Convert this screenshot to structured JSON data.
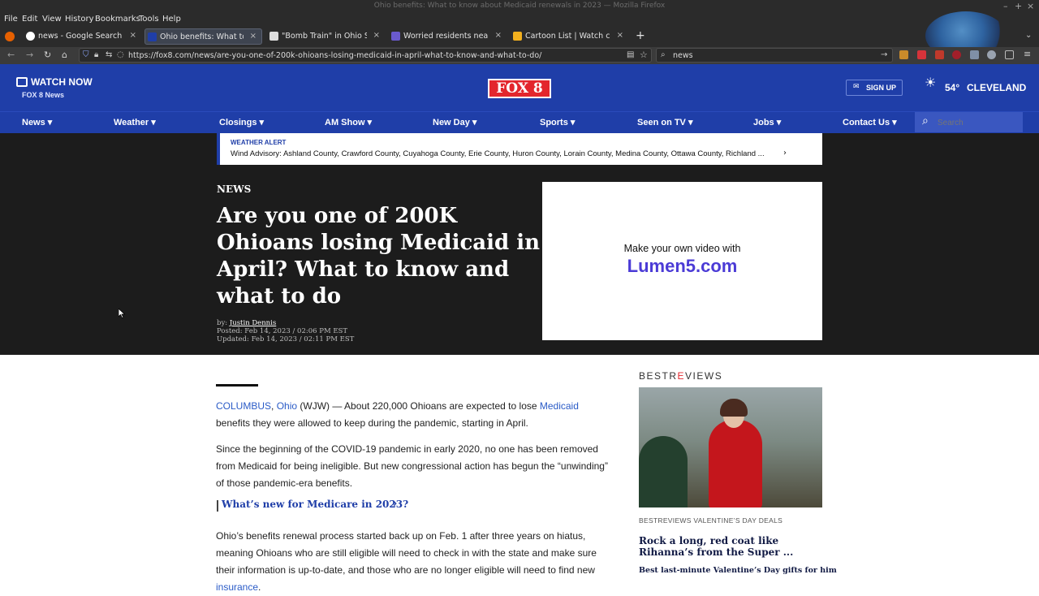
{
  "window": {
    "title": "Ohio benefits: What to know about Medicaid renewals in 2023 — Mozilla Firefox",
    "controls": [
      "–",
      "+",
      "×"
    ]
  },
  "menu": [
    "File",
    "Edit",
    "View",
    "History",
    "Bookmarks",
    "Tools",
    "Help"
  ],
  "tabs": [
    {
      "label": "news - Google Search",
      "active": false
    },
    {
      "label": "Ohio benefits: What to know",
      "active": true
    },
    {
      "label": "\"Bomb Train\" in Ohio Sicken",
      "active": false
    },
    {
      "label": "Worried residents near Ohio",
      "active": false
    },
    {
      "label": "Cartoon List | Watch cartoon",
      "active": false
    }
  ],
  "new_tab": "+",
  "address": {
    "url": "https://fox8.com/news/are-you-one-of-200k-ohioans-losing-medicaid-in-april-what-to-know-and-what-to-do/",
    "search_value": "news"
  },
  "site": {
    "watch_now": "WATCH NOW",
    "watch_sub": "FOX 8 News",
    "logo": "FOX 8",
    "sign_up": "SIGN UP",
    "weather_temp": "54°",
    "weather_city": "CLEVELAND",
    "nav": [
      "News ▾",
      "Weather ▾",
      "Closings ▾",
      "AM Show ▾",
      "New Day ▾",
      "Sports ▾",
      "Seen on TV ▾",
      "Jobs ▾",
      "Contact Us ▾"
    ],
    "search_placeholder": "Search"
  },
  "alert": {
    "label": "WEATHER ALERT",
    "text": "Wind Advisory: Ashland County, Crawford County, Cuyahoga County, Erie County, Huron County, Lorain County, Medina County, Ottawa County, Richland ..."
  },
  "article": {
    "section": "NEWS",
    "headline": "Are you one of 200K Ohioans losing Medicaid in April? What to know and what to do",
    "by_label": "by:",
    "author": "Justin Dennis",
    "posted": "Posted: Feb 14, 2023 / 02:06 PM EST",
    "updated": "Updated: Feb 14, 2023 / 02:11 PM EST",
    "p1_link1": "COLUMBUS",
    "p1_link2": "Ohio",
    "p1_mid": " (WJW) — About 220,000 Ohioans are expected to lose ",
    "p1_link3": "Medicaid",
    "p1_end": " benefits they were allowed to keep during the pandemic, starting in April.",
    "p2": "Since the beginning of the COVID-19 pandemic in early 2020, no one has been removed from Medicaid for being ineligible. But new congressional action has begun the “unwinding” of those pandemic-era benefits.",
    "related": "What’s new for Medicare in 2023?",
    "p3_start": "Ohio’s benefits renewal process started back up on Feb. 1 after three years on hiatus, meaning Ohioans who are still eligible will need to check in with the state and make sure their information is up-to-date, and those who are no longer eligible will need to find new ",
    "p3_link": "insurance",
    "p3_end": "."
  },
  "ad": {
    "line1": "Make your own video with",
    "line2": "Lumen5.com"
  },
  "sidebar": {
    "brand_a": "BESTR",
    "brand_b": "E",
    "brand_c": "VIEWS",
    "kicker": "BESTREVIEWS VALENTINE’S DAY DEALS",
    "headline": "Rock a long, red coat like Rihanna’s from the Super ...",
    "subhead": "Best last-minute Valentine’s Day gifts for him"
  },
  "colors": {
    "site_blue": "#1f3ea8",
    "link_blue": "#2a5bc7",
    "hero_bg": "#1c1c1c",
    "fox_red": "#e3262d"
  }
}
